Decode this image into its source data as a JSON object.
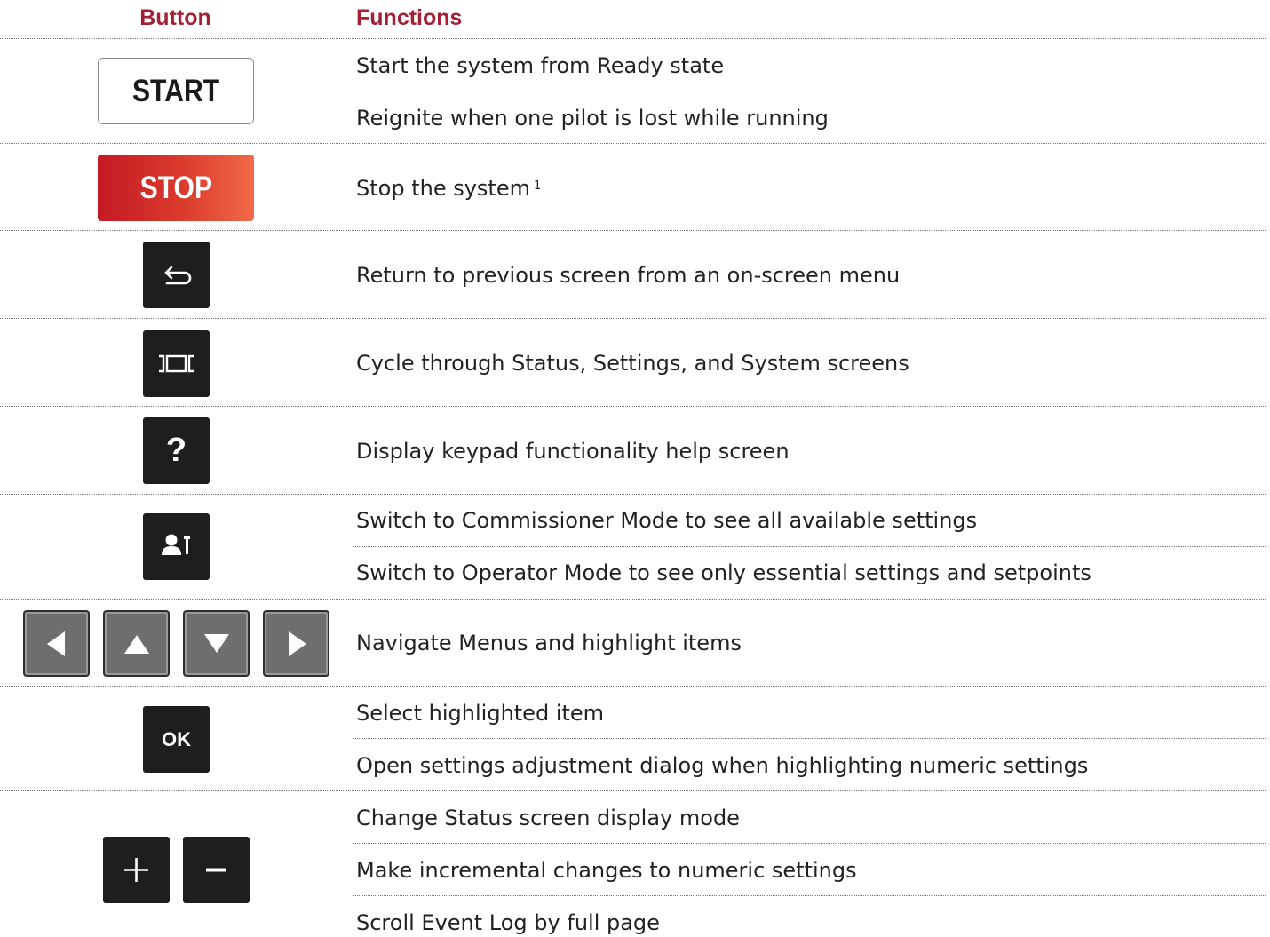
{
  "header": {
    "button": "Button",
    "functions": "Functions"
  },
  "colors": {
    "header": "#a41f35",
    "stop_start": "#c41a24",
    "stop_end": "#ef6a48",
    "dark_button": "#1e1e1e",
    "arrow_button": "#6e6e6e"
  },
  "rows": [
    {
      "button": {
        "label": "START",
        "icon": "start-button"
      },
      "functions": [
        "Start the system from Ready state",
        "Reignite when one pilot is lost while running"
      ]
    },
    {
      "button": {
        "label": "STOP",
        "icon": "stop-button"
      },
      "functions": [
        "Stop the system"
      ],
      "footnote": "1"
    },
    {
      "button": {
        "icon": "return-arrow-icon"
      },
      "functions": [
        "Return to previous screen from an on-screen menu"
      ]
    },
    {
      "button": {
        "icon": "screen-cycle-icon"
      },
      "functions": [
        "Cycle through Status, Settings, and System screens"
      ]
    },
    {
      "button": {
        "label": "?",
        "icon": "help-icon"
      },
      "functions": [
        "Display keypad functionality help screen"
      ]
    },
    {
      "button": {
        "icon": "person-wrench-icon"
      },
      "functions": [
        "Switch to Commissioner Mode to see all available settings",
        "Switch to Operator Mode to see only essential settings and setpoints"
      ]
    },
    {
      "button": {
        "icon": "arrow-keys-icon"
      },
      "functions": [
        "Navigate Menus and highlight items"
      ]
    },
    {
      "button": {
        "label": "OK",
        "icon": "ok-button"
      },
      "functions": [
        "Select highlighted item",
        "Open settings adjustment dialog when highlighting numeric settings"
      ]
    },
    {
      "button": {
        "icon": "plus-minus-icon"
      },
      "functions": [
        "Change Status screen display mode",
        "Make incremental changes to numeric settings",
        "Scroll Event Log by full page"
      ]
    }
  ]
}
